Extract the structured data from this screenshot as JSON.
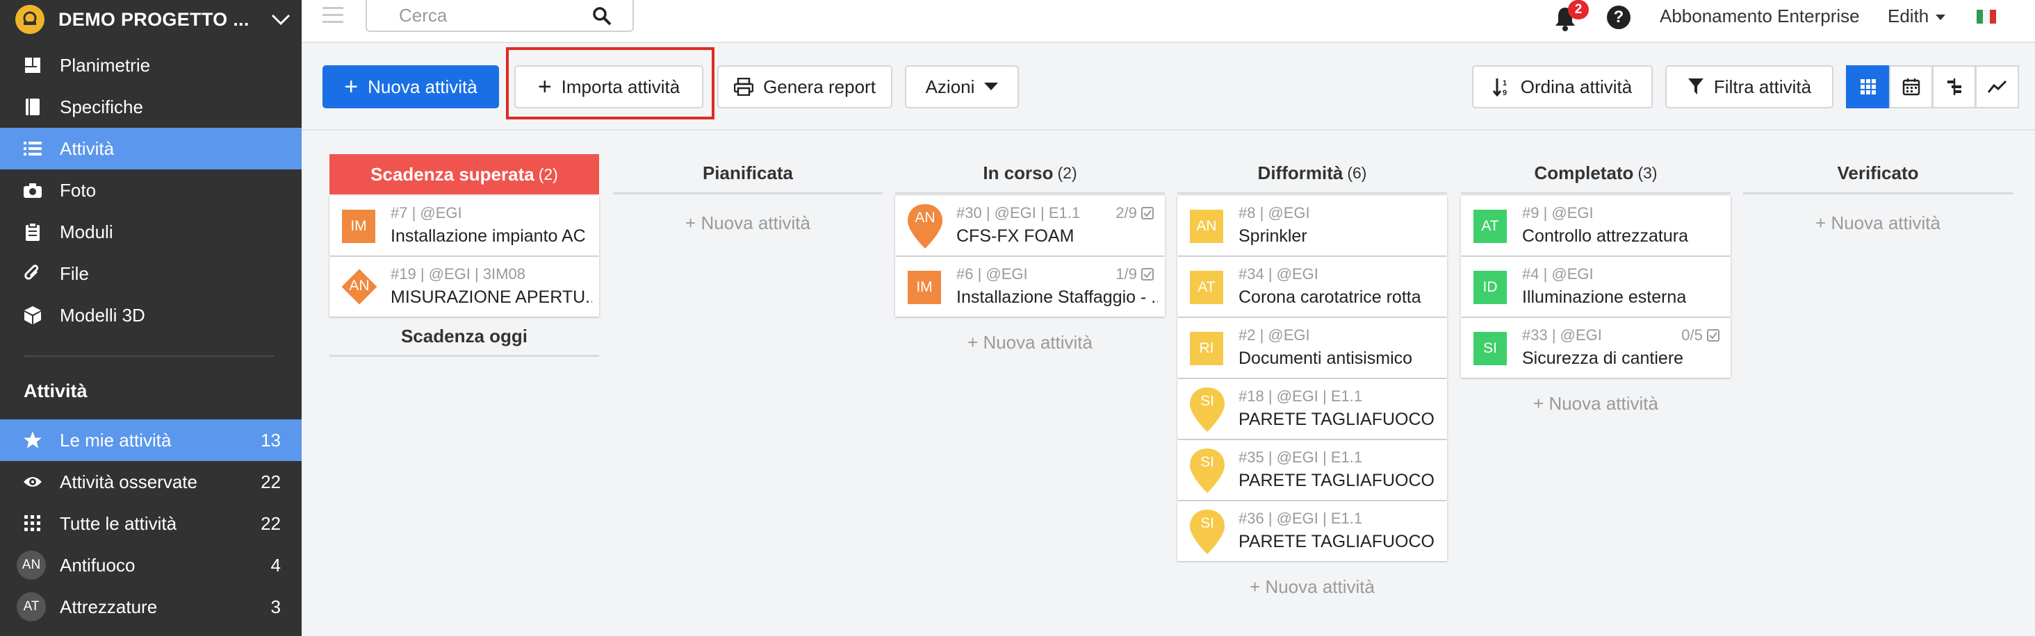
{
  "colors": {
    "sidebar_bg": "#323232",
    "sidebar_active": "#5b97ec",
    "primary": "#1a6fe6",
    "overdue": "#f0544e",
    "orange": "#f0883e",
    "yellow": "#f7c948",
    "green": "#3ecf6a",
    "highlight_box": "#e02b1f"
  },
  "sidebar": {
    "project": "DEMO PROGETTO ...",
    "nav": [
      {
        "label": "Planimetrie",
        "icon": "floorplan-icon"
      },
      {
        "label": "Specifiche",
        "icon": "book-icon"
      },
      {
        "label": "Attività",
        "icon": "list-icon",
        "active": true
      },
      {
        "label": "Foto",
        "icon": "camera-icon"
      },
      {
        "label": "Moduli",
        "icon": "clipboard-icon"
      },
      {
        "label": "File",
        "icon": "paperclip-icon"
      },
      {
        "label": "Modelli 3D",
        "icon": "cube-icon"
      }
    ],
    "section_title": "Attività",
    "filters": [
      {
        "label": "Le mie attività",
        "count": "13",
        "icon": "star-icon",
        "active": true
      },
      {
        "label": "Attività osservate",
        "count": "22",
        "icon": "eye-icon"
      },
      {
        "label": "Tutte le attività",
        "count": "22",
        "icon": "grid-dots-icon"
      },
      {
        "label": "Antifuoco",
        "count": "4",
        "avatar": "AN"
      },
      {
        "label": "Attrezzature",
        "count": "3",
        "avatar": "AT"
      }
    ]
  },
  "topbar": {
    "search_placeholder": "Cerca",
    "notifications": "2",
    "help": "?",
    "plan": "Abbonamento Enterprise",
    "user": "Edith"
  },
  "toolbar": {
    "new_activity": "Nuova attività",
    "import_activity": "Importa attività",
    "report": "Genera report",
    "actions": "Azioni",
    "sort": "Ordina attività",
    "filter": "Filtra attività"
  },
  "board": {
    "add_label": "+ Nuova attività",
    "today_label": "Scadenza oggi",
    "columns": [
      {
        "title": "Scadenza superata",
        "count": "(2)",
        "cards": [
          {
            "badge": "IM",
            "shape": "square",
            "color": "#f0883e",
            "meta": "#7 | @EGI",
            "title": "Installazione impianto AC"
          },
          {
            "badge": "AN",
            "shape": "diamond",
            "color": "#f0883e",
            "meta": "#19 | @EGI | 3IM08",
            "title": "MISURAZIONE APERTU..."
          }
        ]
      },
      {
        "title": "Pianificata",
        "count": "",
        "cards": []
      },
      {
        "title": "In corso",
        "count": "(2)",
        "cards": [
          {
            "badge": "AN",
            "shape": "pin",
            "color": "#f0883e",
            "meta": "#30 | @EGI | E1.1",
            "title": "CFS-FX FOAM",
            "check": "2/9"
          },
          {
            "badge": "IM",
            "shape": "square",
            "color": "#f0883e",
            "meta": "#6 | @EGI",
            "title": "Installazione Staffaggio - ...",
            "check": "1/9"
          }
        ]
      },
      {
        "title": "Difformità",
        "count": "(6)",
        "cards": [
          {
            "badge": "AN",
            "shape": "square",
            "color": "#f7c948",
            "meta": "#8 | @EGI",
            "title": "Sprinkler"
          },
          {
            "badge": "AT",
            "shape": "square",
            "color": "#f7c948",
            "meta": "#34 | @EGI",
            "title": "Corona carotatrice rotta"
          },
          {
            "badge": "RI",
            "shape": "square",
            "color": "#f7c948",
            "meta": "#2 | @EGI",
            "title": "Documenti antisismico"
          },
          {
            "badge": "SI",
            "shape": "pin",
            "color": "#f7c948",
            "meta": "#18 | @EGI | E1.1",
            "title": "PARETE TAGLIAFUOCO"
          },
          {
            "badge": "SI",
            "shape": "pin",
            "color": "#f7c948",
            "meta": "#35 | @EGI | E1.1",
            "title": "PARETE TAGLIAFUOCO"
          },
          {
            "badge": "SI",
            "shape": "pin",
            "color": "#f7c948",
            "meta": "#36 | @EGI | E1.1",
            "title": "PARETE TAGLIAFUOCO"
          }
        ]
      },
      {
        "title": "Completato",
        "count": "(3)",
        "cards": [
          {
            "badge": "AT",
            "shape": "square",
            "color": "#3ecf6a",
            "meta": "#9 | @EGI",
            "title": "Controllo attrezzatura"
          },
          {
            "badge": "ID",
            "shape": "square",
            "color": "#3ecf6a",
            "meta": "#4 | @EGI",
            "title": "Illuminazione esterna"
          },
          {
            "badge": "SI",
            "shape": "square",
            "color": "#3ecf6a",
            "meta": "#33 | @EGI",
            "title": "Sicurezza di cantiere",
            "check": "0/5"
          }
        ]
      },
      {
        "title": "Verificato",
        "count": "",
        "cards": []
      }
    ]
  }
}
